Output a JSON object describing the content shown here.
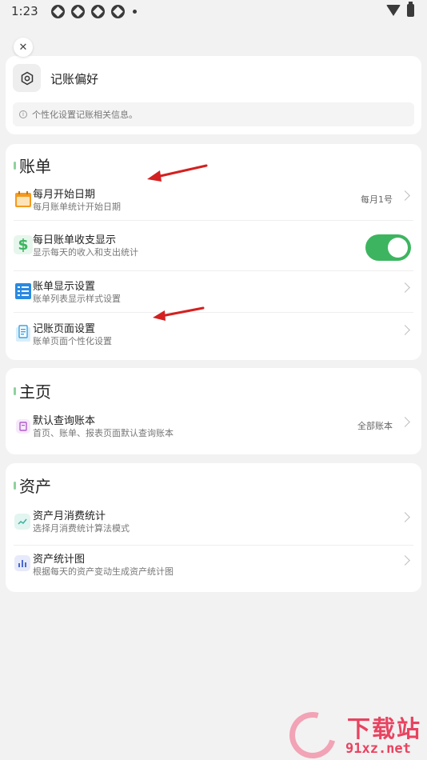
{
  "status_bar": {
    "time": "1:23"
  },
  "preferences": {
    "title": "记账偏好",
    "info": "个性化设置记账相关信息。"
  },
  "sections": [
    {
      "title": "账单",
      "items": [
        {
          "title": "每月开始日期",
          "subtitle": "每月账单统计开始日期",
          "value": "每月1号",
          "icon": "calendar-icon",
          "icon_color": "#f59a1c"
        },
        {
          "title": "每日账单收支显示",
          "subtitle": "显示每天的收入和支出统计",
          "toggle": true,
          "icon": "dollar-icon",
          "icon_color": "#3db560"
        },
        {
          "title": "账单显示设置",
          "subtitle": "账单列表显示样式设置",
          "icon": "list-icon",
          "icon_color": "#2a8ae0"
        },
        {
          "title": "记账页面设置",
          "subtitle": "账单页面个性化设置",
          "icon": "receipt-icon",
          "icon_color": "#3aa3e0"
        }
      ]
    },
    {
      "title": "主页",
      "items": [
        {
          "title": "默认查询账本",
          "subtitle": "首页、账单、报表页面默认查询账本",
          "value": "全部账本",
          "icon": "ledger-icon",
          "icon_color": "#b05cc9"
        }
      ]
    },
    {
      "title": "资产",
      "items": [
        {
          "title": "资产月消费统计",
          "subtitle": "选择月消费统计算法模式",
          "icon": "trend-icon",
          "icon_color": "#3db5a0"
        },
        {
          "title": "资产统计图",
          "subtitle": "根据每天的资产变动生成资产统计图",
          "icon": "bar-chart-icon",
          "icon_color": "#4a6ad0"
        }
      ]
    }
  ],
  "watermark": {
    "text": "下载站",
    "url": "91xz.net"
  },
  "colors": {
    "accent_green": "#3db560",
    "arrow_red": "#d42020",
    "watermark": "#e84360"
  }
}
